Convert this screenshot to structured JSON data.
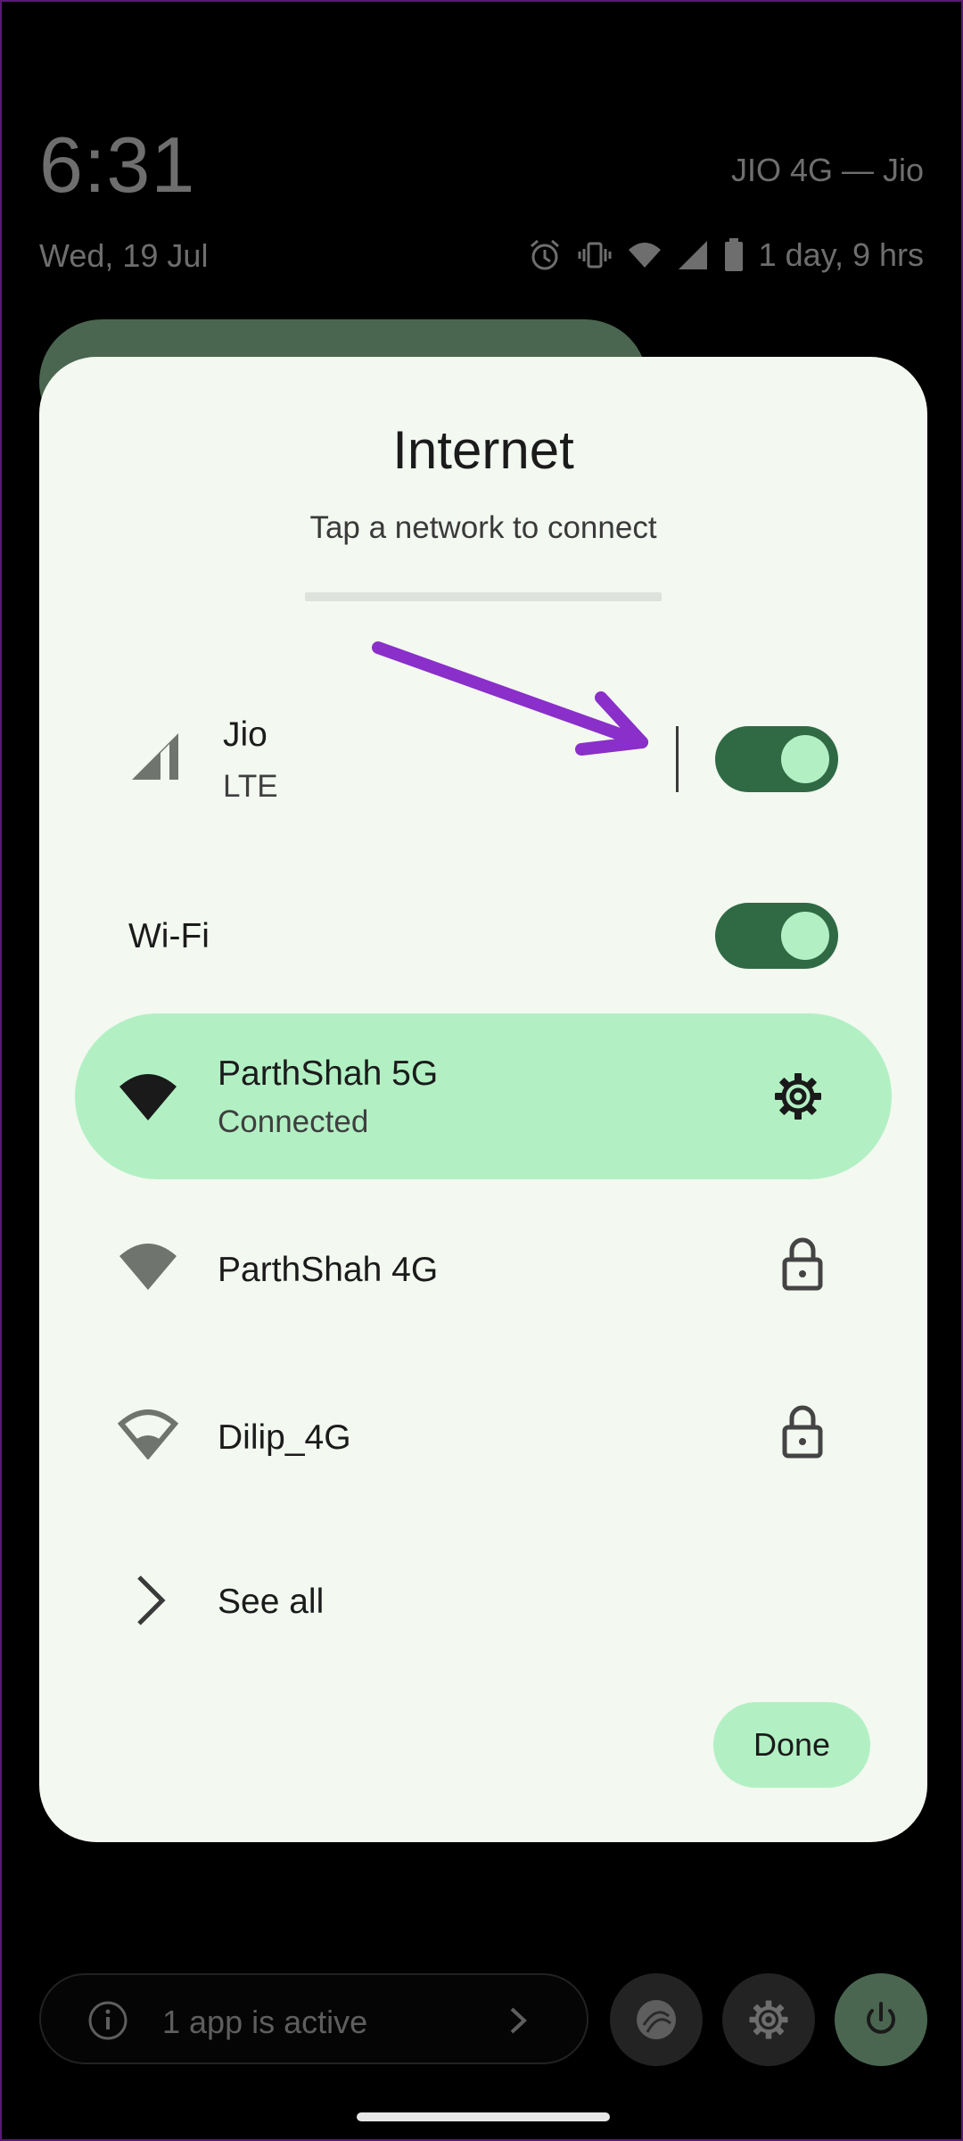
{
  "status": {
    "time": "6:31",
    "date": "Wed, 19 Jul",
    "carrier": "JIO 4G — Jio",
    "battery_text": "1 day, 9 hrs",
    "icons": [
      "alarm-icon",
      "vibrate-icon",
      "wifi-icon",
      "cell-signal-icon",
      "battery-icon"
    ]
  },
  "dialog": {
    "title": "Internet",
    "subtitle": "Tap a network to connect",
    "mobile": {
      "name": "Jio",
      "type": "LTE",
      "enabled": true
    },
    "wifi": {
      "label": "Wi-Fi",
      "enabled": true
    },
    "networks": [
      {
        "name": "ParthShah 5G",
        "status": "Connected",
        "action_icon": "gear-icon"
      },
      {
        "name": "ParthShah 4G",
        "action_icon": "lock-icon"
      },
      {
        "name": "Dilip_4G",
        "action_icon": "lock-icon"
      }
    ],
    "see_all": "See all",
    "done": "Done"
  },
  "bottom": {
    "active_apps": "1 app is active"
  },
  "colors": {
    "dialog_bg": "#f3f8f0",
    "accent_light": "#b2f0c4",
    "switch_on": "#2f6a44",
    "annotation_arrow": "#8a2fc9"
  }
}
